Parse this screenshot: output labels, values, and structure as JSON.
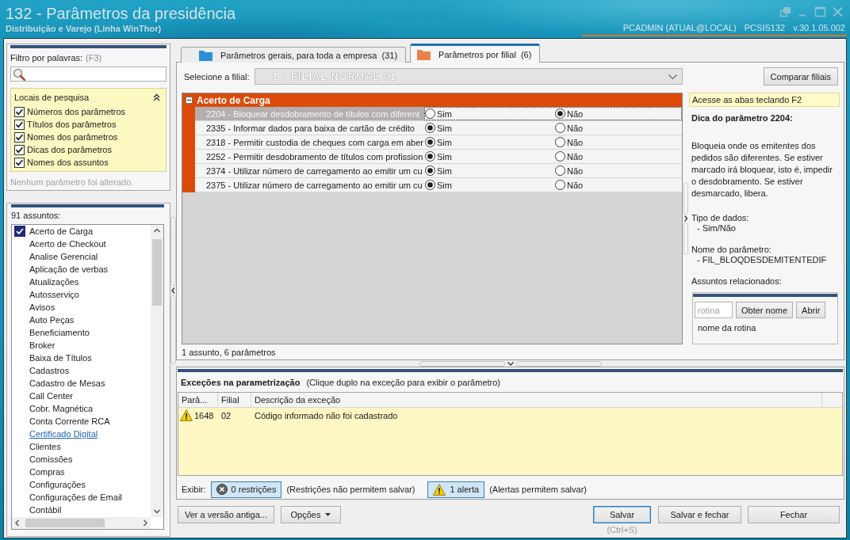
{
  "window": {
    "title": "132 - Parâmetros da presidência",
    "subtitle": "Distribuição e Varejo (Linha WinThor)",
    "user": "PCADMIN (ATUAL@LOCAL)",
    "program": "PCSIS132",
    "version": "v.30.1.05.002"
  },
  "filter": {
    "label": "Filtro por palavras:",
    "shortcut": "(F3)",
    "search_places": {
      "title": "Locais de pesquisa",
      "expanded": true,
      "options": [
        {
          "label": "Números dos parâmetros",
          "checked": true
        },
        {
          "label": "Títulos dos parâmetros",
          "checked": true
        },
        {
          "label": "Nomes dos parâmetros",
          "checked": true
        },
        {
          "label": "Dicas dos parâmetros",
          "checked": true
        },
        {
          "label": "Nomes dos assuntos",
          "checked": true
        }
      ]
    },
    "status": "Nenhum parâmetro foi alterado."
  },
  "subjects": {
    "count": "91 assuntos:",
    "items": [
      {
        "label": "Acerto de Carga",
        "checked": true,
        "hovered": false
      },
      {
        "label": "Acerto de Checkout",
        "checked": false,
        "hovered": false
      },
      {
        "label": "Analise Gerencial",
        "checked": false,
        "hovered": false
      },
      {
        "label": "Aplicação de verbas",
        "checked": false,
        "hovered": false
      },
      {
        "label": "Atualizações",
        "checked": false,
        "hovered": false
      },
      {
        "label": "Autosserviço",
        "checked": false,
        "hovered": false
      },
      {
        "label": "Avisos",
        "checked": false,
        "hovered": false
      },
      {
        "label": "Auto Peças",
        "checked": false,
        "hovered": false
      },
      {
        "label": "Beneficiamento",
        "checked": false,
        "hovered": false
      },
      {
        "label": "Broker",
        "checked": false,
        "hovered": false
      },
      {
        "label": "Baixa de Títulos",
        "checked": false,
        "hovered": false
      },
      {
        "label": "Cadastros",
        "checked": false,
        "hovered": false
      },
      {
        "label": "Cadastro de Mesas",
        "checked": false,
        "hovered": false
      },
      {
        "label": "Call Center",
        "checked": false,
        "hovered": false
      },
      {
        "label": "Cobr. Magnética",
        "checked": false,
        "hovered": false
      },
      {
        "label": "Conta Corrente RCA",
        "checked": false,
        "hovered": false
      },
      {
        "label": "Certificado Digital",
        "checked": false,
        "hovered": true
      },
      {
        "label": "Clientes",
        "checked": false,
        "hovered": false
      },
      {
        "label": "Comissões",
        "checked": false,
        "hovered": false
      },
      {
        "label": "Compras",
        "checked": false,
        "hovered": false
      },
      {
        "label": "Configurações",
        "checked": false,
        "hovered": false
      },
      {
        "label": "Configurações de Email",
        "checked": false,
        "hovered": false
      },
      {
        "label": "Contábil",
        "checked": false,
        "hovered": false
      }
    ]
  },
  "tabs": [
    {
      "label": "Parâmetros gerais, para toda a empresa",
      "count": "(31)",
      "color": "#2a8fd6",
      "selected": false
    },
    {
      "label": "Parâmetros por filial",
      "count": "(6)",
      "color": "#e8824a",
      "selected": true
    }
  ],
  "branch": {
    "label": "Selecione a filial:",
    "value": "1 - FILIAL NORMAL 01",
    "disabled": true,
    "compare_button": "Comparar filiais"
  },
  "parameter_groups": [
    {
      "title": "Acerto de Carga",
      "expanded": true,
      "parameters": [
        {
          "label": "2204 - Bloquear desdobramento de títulos com diferent",
          "selected": true,
          "options": [
            {
              "label": "Sim",
              "selected": false
            },
            {
              "label": "Não",
              "selected": true
            }
          ]
        },
        {
          "label": "2335 - Informar dados para baixa de cartão de crédito",
          "selected": false,
          "options": [
            {
              "label": "Sim",
              "selected": true
            },
            {
              "label": "Não",
              "selected": false
            }
          ]
        },
        {
          "label": "2318 - Permitir custodia de cheques com carga em aber",
          "selected": false,
          "options": [
            {
              "label": "Sim",
              "selected": true
            },
            {
              "label": "Não",
              "selected": false
            }
          ]
        },
        {
          "label": "2252 - Permitir desdobramento de títulos com profission",
          "selected": false,
          "options": [
            {
              "label": "Sim",
              "selected": true
            },
            {
              "label": "Não",
              "selected": false
            }
          ]
        },
        {
          "label": "2374 - Utilizar número de carregamento ao emitir um cu",
          "selected": false,
          "options": [
            {
              "label": "Sim",
              "selected": true
            },
            {
              "label": "Não",
              "selected": false
            }
          ]
        },
        {
          "label": "2375 - Utilizar número de carregamento ao emitir um cu",
          "selected": false,
          "options": [
            {
              "label": "Sim",
              "selected": true
            },
            {
              "label": "Não",
              "selected": false
            }
          ]
        }
      ]
    }
  ],
  "summary": "1 assunto, 6 parâmetros",
  "help": {
    "hint": "Acesse as abas teclando F2",
    "title": "Dica do parâmetro 2204:",
    "description": "Bloqueia onde os emitentes dos pedidos são diferentes. Se estiver marcado irá bloquear, isto é, impedir o desdobramento. Se estiver desmarcado, libera.",
    "sections": [
      {
        "heading": "Tipo de dados:",
        "value": "- Sim/Não"
      },
      {
        "heading": "Nome do parâmetro:",
        "value": "- FIL_BLOQDESDEMITENTEDIF"
      },
      {
        "heading": "Assuntos relacionados:"
      }
    ]
  },
  "routine_lookup": {
    "placeholder": "rotina",
    "buttons": [
      "Obter nome",
      "Abrir"
    ],
    "result": "nome da rotina"
  },
  "exceptions": {
    "title": "Exceções na parametrização",
    "hint": "(Clique duplo na exceção para exibir o parâmetro)",
    "columns": [
      "Parâ...",
      "Filial",
      "Descrição da exceção"
    ],
    "rows": [
      {
        "kind": "alert",
        "cells": [
          "1648",
          "02",
          "Código informado não foi cadastrado"
        ]
      }
    ],
    "filter_label": "Exibir:",
    "filters": [
      {
        "kind": "restriction",
        "label": "0 restrições",
        "on": true,
        "note": "(Restrições não permitem salvar)"
      },
      {
        "kind": "alert",
        "label": "1 alerta",
        "on": true,
        "note": "(Alertas permitem salvar)"
      }
    ]
  },
  "footer": {
    "left_buttons": [
      {
        "kind": "plain",
        "label": "Ver a versão antiga..."
      },
      {
        "kind": "menu",
        "label": "Opções"
      }
    ],
    "right_buttons": [
      {
        "label": "Salvar",
        "default": true,
        "shortcut": "(Ctrl+S)"
      },
      {
        "label": "Salvar e fechar",
        "default": false
      },
      {
        "label": "Fechar",
        "default": false
      }
    ]
  }
}
